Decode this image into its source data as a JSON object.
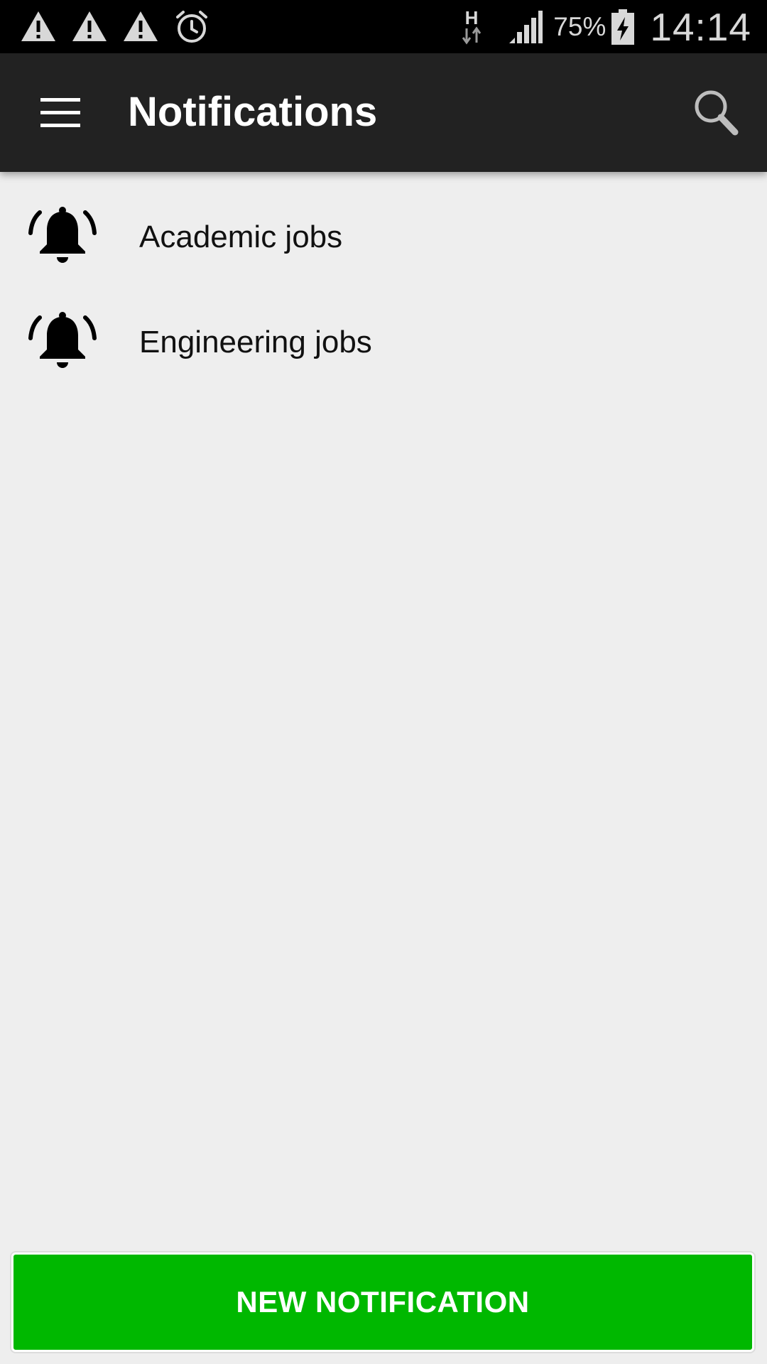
{
  "status_bar": {
    "left_icons": [
      "warning-icon",
      "warning-icon",
      "warning-icon",
      "alarm-icon"
    ],
    "network_type": "H",
    "battery_percent": "75%",
    "time": "14:14"
  },
  "app_bar": {
    "title": "Notifications",
    "menu_icon": "hamburger-menu-icon",
    "search_icon": "search-icon",
    "background": "#222222"
  },
  "notifications": [
    {
      "label": "Academic jobs",
      "icon": "bell-ringing-icon"
    },
    {
      "label": "Engineering jobs",
      "icon": "bell-ringing-icon"
    }
  ],
  "new_button": {
    "label": "NEW NOTIFICATION",
    "color": "#00b800"
  }
}
